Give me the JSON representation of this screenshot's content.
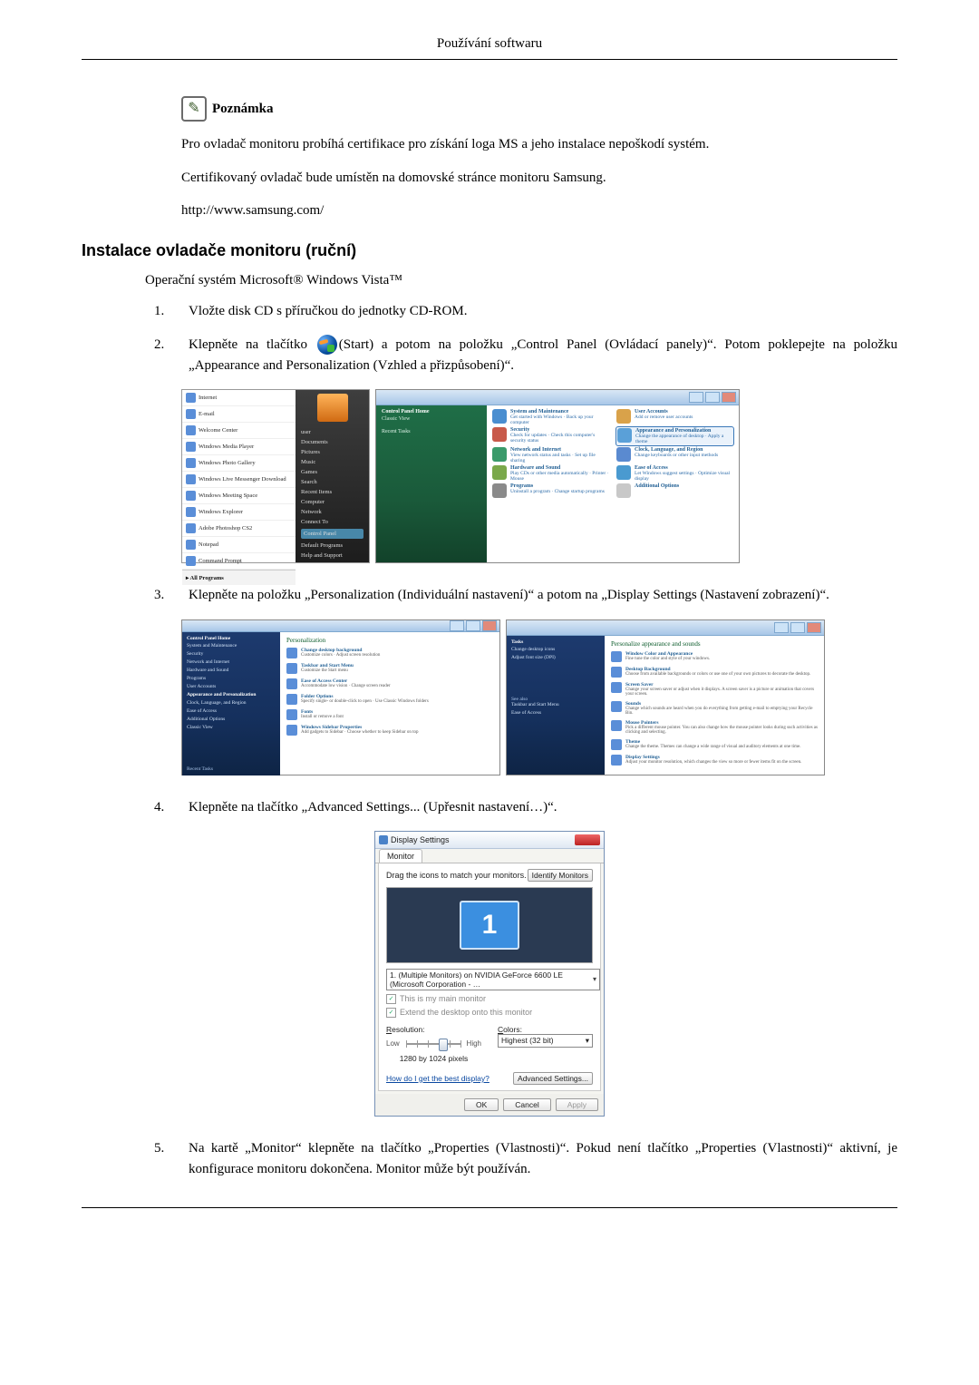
{
  "header": {
    "title": "Používání softwaru"
  },
  "note": {
    "label": "Poznámka",
    "p1": "Pro ovladač monitoru probíhá certifikace pro získání loga MS a jeho instalace nepoškodí systém.",
    "p2": "Certifikovaný ovladač bude umístěn na domovské stránce monitoru Samsung.",
    "p3": "http://www.samsung.com/"
  },
  "section": {
    "title": "Instalace ovladače monitoru (ruční)"
  },
  "os_line": "Operační systém Microsoft® Windows Vista™",
  "steps": {
    "n1": "1.",
    "s1": "Vložte disk CD s příručkou do jednotky CD-ROM.",
    "n2": "2.",
    "s2a": "Klepněte na tlačítko ",
    "s2b": "(Start) a potom na položku „Control Panel (Ovládací panely)“. Potom poklepejte na položku „Appearance and Personalization (Vzhled a přizpůsobení)“.",
    "n3": "3.",
    "s3": "Klepněte na položku „Personalization (Individuální nastavení)“ a potom na „Display Settings (Nastavení zobrazení)“.",
    "n4": "4.",
    "s4": "Klepněte na tlačítko „Advanced Settings... (Upřesnit nastavení…)“.",
    "n5": "5.",
    "s5": "Na kartě „Monitor“ klepněte na tlačítko „Properties (Vlastnosti)“. Pokud není tlačítko „Properties (Vlastnosti)“ aktivní, je konfigurace monitoru dokončena. Monitor může být používán."
  },
  "startmenu": {
    "items": [
      "Internet",
      "E-mail",
      "Welcome Center",
      "Windows Media Player",
      "Windows Photo Gallery",
      "Windows Live Messenger Download",
      "Windows Meeting Space",
      "Windows Explorer",
      "Adobe Photoshop CS2",
      "Notepad",
      "Command Prompt"
    ],
    "all": "All Programs",
    "right": [
      "user",
      "Documents",
      "Pictures",
      "Music",
      "Games",
      "Search",
      "Recent Items",
      "Computer",
      "Network",
      "Connect To",
      "Control Panel",
      "Default Programs",
      "Help and Support"
    ]
  },
  "controlpanel": {
    "side_title": "Control Panel Home",
    "side_link": "Classic View",
    "side_recent": "Recent Tasks",
    "items_left": [
      {
        "t": "System and Maintenance",
        "s": "Get started with Windows · Back up your computer"
      },
      {
        "t": "Security",
        "s": "Check for updates · Check this computer's security status"
      },
      {
        "t": "Network and Internet",
        "s": "View network status and tasks · Set up file sharing"
      },
      {
        "t": "Hardware and Sound",
        "s": "Play CDs or other media automatically · Printer · Mouse"
      },
      {
        "t": "Programs",
        "s": "Uninstall a program · Change startup programs"
      }
    ],
    "items_right": [
      {
        "t": "User Accounts",
        "s": "Add or remove user accounts"
      },
      {
        "t": "Appearance and Personalization",
        "s": "Change the appearance of desktop · Apply a theme"
      },
      {
        "t": "Clock, Language, and Region",
        "s": "Change keyboards or other input methods"
      },
      {
        "t": "Ease of Access",
        "s": "Let Windows suggest settings · Optimize visual display"
      },
      {
        "t": "Additional Options",
        "s": ""
      }
    ]
  },
  "personA": {
    "side_title": "Control Panel Home",
    "side_items": [
      "System and Maintenance",
      "Security",
      "Network and Internet",
      "Hardware and Sound",
      "Programs",
      "User Accounts",
      "Appearance and Personalization",
      "Clock, Language, and Region",
      "Ease of Access",
      "Additional Options",
      "Classic View"
    ],
    "side_foot": "Recent Tasks",
    "main_title": "Personalization",
    "entries": [
      {
        "l": "Change desktop background",
        "s": "Customize colors · Adjust screen resolution"
      },
      {
        "l": "Taskbar and Start Menu",
        "s": "Customize the Start menu"
      },
      {
        "l": "Ease of Access Center",
        "s": "Accommodate low vision · Change screen reader"
      },
      {
        "l": "Folder Options",
        "s": "Specify single- or double-click to open · Use Classic Windows folders"
      },
      {
        "l": "Fonts",
        "s": "Install or remove a font"
      },
      {
        "l": "Windows Sidebar Properties",
        "s": "Add gadgets to Sidebar · Choose whether to keep Sidebar on top"
      }
    ]
  },
  "personB": {
    "side_title": "Tasks",
    "side_items": [
      "Change desktop icons",
      "Adjust font size (DPI)"
    ],
    "side_foot": "See also",
    "side_foot_items": [
      "Taskbar and Start Menu",
      "Ease of Access"
    ],
    "main_title": "Personalize appearance and sounds",
    "entries": [
      {
        "l": "Window Color and Appearance",
        "s": "Fine tune the color and style of your windows."
      },
      {
        "l": "Desktop Background",
        "s": "Choose from available backgrounds or colors or use one of your own pictures to decorate the desktop."
      },
      {
        "l": "Screen Saver",
        "s": "Change your screen saver or adjust when it displays. A screen saver is a picture or animation that covers your screen."
      },
      {
        "l": "Sounds",
        "s": "Change which sounds are heard when you do everything from getting e-mail to emptying your Recycle Bin."
      },
      {
        "l": "Mouse Pointers",
        "s": "Pick a different mouse pointer. You can also change how the mouse pointer looks during such activities as clicking and selecting."
      },
      {
        "l": "Theme",
        "s": "Change the theme. Themes can change a wide range of visual and auditory elements at one time."
      },
      {
        "l": "Display Settings",
        "s": "Adjust your monitor resolution, which changes the view so more or fewer items fit on the screen."
      }
    ]
  },
  "display": {
    "title": "Display Settings",
    "tab": "Monitor",
    "drag": "Drag the icons to match your monitors.",
    "identify": "Identify Monitors",
    "monnum": "1",
    "combo": "1. (Multiple Monitors) on NVIDIA GeForce 6600 LE (Microsoft Corporation - …",
    "chk1": "This is my main monitor",
    "chk2": "Extend the desktop onto this monitor",
    "res_label": "Resolution:",
    "low": "Low",
    "high": "High",
    "res_val": "1280 by 1024 pixels",
    "col_label": "Colors:",
    "col_val": "Highest (32 bit)",
    "help": "How do I get the best display?",
    "adv": "Advanced Settings...",
    "ok": "OK",
    "cancel": "Cancel",
    "apply": "Apply"
  }
}
